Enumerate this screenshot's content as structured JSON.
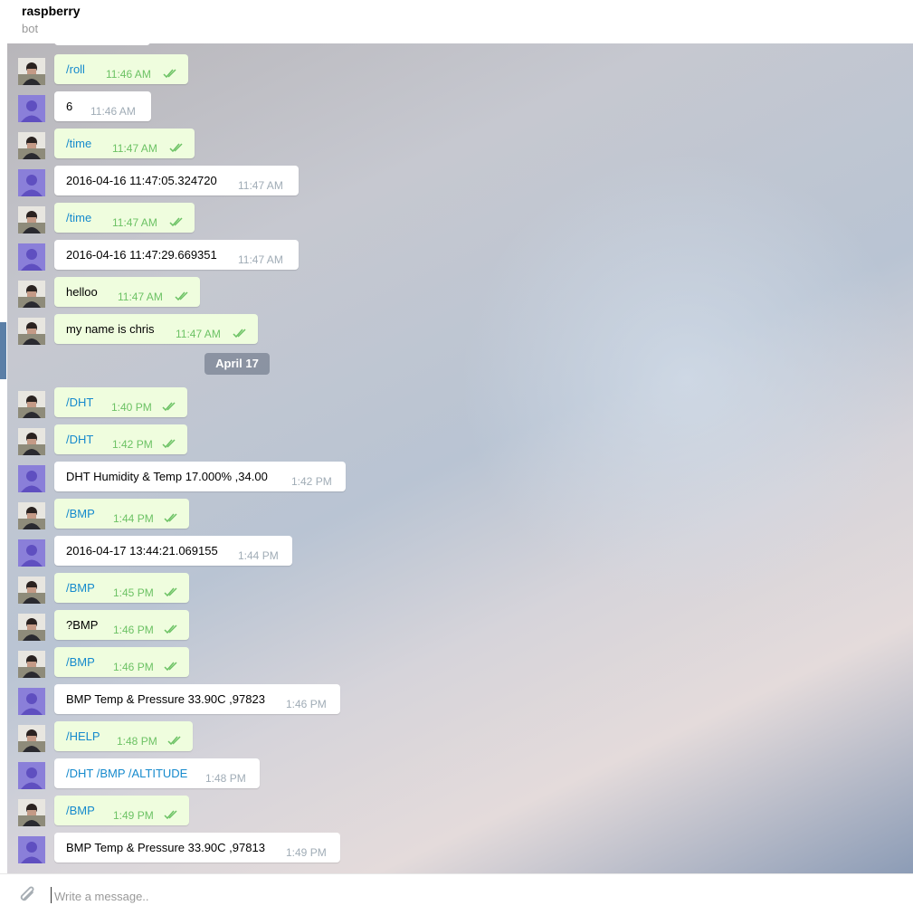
{
  "header": {
    "title": "raspberry",
    "subtitle": "bot"
  },
  "date_separator": "April 17",
  "composer": {
    "placeholder": "Write a message.."
  },
  "messages": [
    {
      "dir": "out",
      "text": "/roll",
      "time": "11:46 AM",
      "cmd": true
    },
    {
      "dir": "in",
      "text": "6",
      "time": "11:46 AM"
    },
    {
      "dir": "out",
      "text": "/time",
      "time": "11:47 AM",
      "cmd": true
    },
    {
      "dir": "in",
      "text": "2016-04-16 11:47:05.324720",
      "time": "11:47 AM"
    },
    {
      "dir": "out",
      "text": "/time",
      "time": "11:47 AM",
      "cmd": true
    },
    {
      "dir": "in",
      "text": "2016-04-16 11:47:29.669351",
      "time": "11:47 AM"
    },
    {
      "dir": "out",
      "text": "helloo",
      "time": "11:47 AM"
    },
    {
      "dir": "out",
      "text": "my name is chris",
      "time": "11:47 AM"
    },
    {
      "dir": "out",
      "text": "/DHT",
      "time": "1:40 PM",
      "cmd": true
    },
    {
      "dir": "out",
      "text": "/DHT",
      "time": "1:42 PM",
      "cmd": true
    },
    {
      "dir": "in",
      "text": "DHT Humidity & Temp 17.000% ,34.00",
      "time": "1:42 PM"
    },
    {
      "dir": "out",
      "text": "/BMP",
      "time": "1:44 PM",
      "cmd": true
    },
    {
      "dir": "in",
      "text": "2016-04-17 13:44:21.069155",
      "time": "1:44 PM"
    },
    {
      "dir": "out",
      "text": "/BMP",
      "time": "1:45 PM",
      "cmd": true
    },
    {
      "dir": "out",
      "text": "?BMP",
      "time": "1:46 PM"
    },
    {
      "dir": "out",
      "text": "/BMP",
      "time": "1:46 PM",
      "cmd": true
    },
    {
      "dir": "in",
      "text": "BMP Temp & Pressure 33.90C ,97823",
      "time": "1:46 PM"
    },
    {
      "dir": "out",
      "text": "/HELP",
      "time": "1:48 PM",
      "cmd": true
    },
    {
      "dir": "in",
      "text": "/DHT /BMP /ALTITUDE",
      "time": "1:48 PM",
      "cmd": true
    },
    {
      "dir": "out",
      "text": "/BMP",
      "time": "1:49 PM",
      "cmd": true
    },
    {
      "dir": "in",
      "text": "BMP Temp & Pressure 33.90C ,97813",
      "time": "1:49 PM"
    }
  ]
}
